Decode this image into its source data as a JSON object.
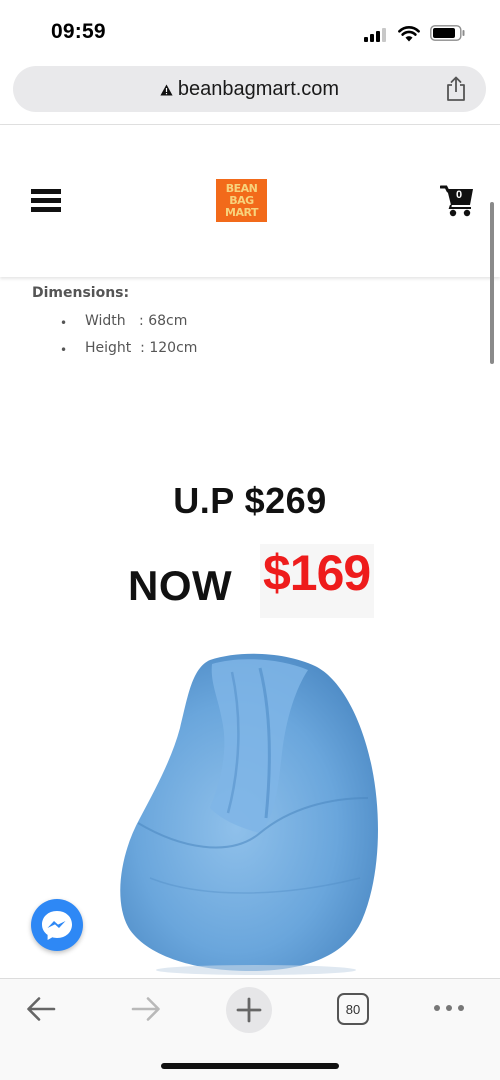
{
  "status_bar": {
    "time": "09:59"
  },
  "browser": {
    "url": "beanbagmart.com",
    "secure_icon": "warning-triangle-icon",
    "share_icon": "share-icon"
  },
  "site_header": {
    "menu_icon": "hamburger-icon",
    "logo_lines": [
      "BEAN",
      "BAG",
      "MART"
    ],
    "cart_icon": "cart-icon",
    "cart_count": "0"
  },
  "product": {
    "dimensions_title": "Dimensions:",
    "dimensions": [
      {
        "label": "Width   : 68cm"
      },
      {
        "label": "Height  : 120cm"
      }
    ],
    "usual_price": "U.P $269",
    "now_label": "NOW",
    "now_price": "$169",
    "image_color": "#6ea9dd"
  },
  "floating": {
    "messenger_icon": "messenger-icon"
  },
  "toolbar": {
    "back_icon": "back-arrow-icon",
    "forward_icon": "forward-arrow-icon",
    "new_tab_icon": "plus-icon",
    "tab_count": "80",
    "more_icon": "more-dots-icon"
  }
}
